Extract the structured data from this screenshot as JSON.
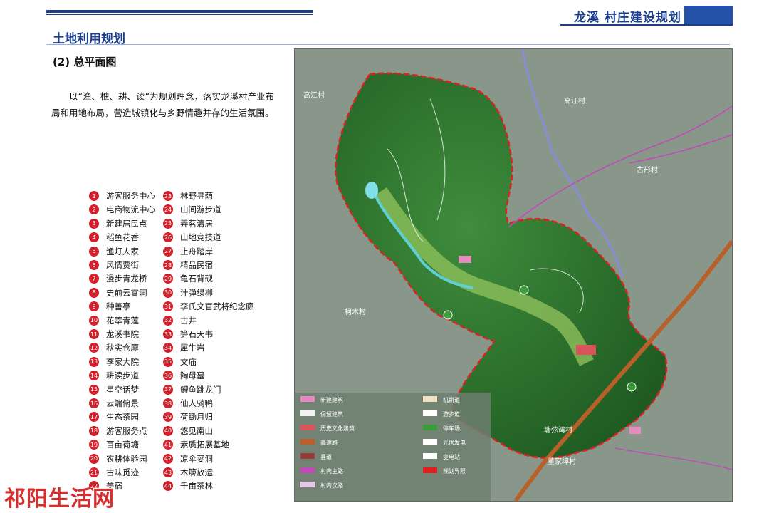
{
  "header": {
    "brand_title": "龙溪 村庄建设规划",
    "section_title": "土地利用规划",
    "subtitle": "(2) 总平面图",
    "paragraph": "以“渔、樵、耕、读”为规划理念，落实龙溪村产业布局和用地布局，营造城镇化与乡野情趣并存的生活氛围。"
  },
  "legend_left": [
    {
      "n": "1",
      "label": "游客服务中心"
    },
    {
      "n": "2",
      "label": "电商物流中心"
    },
    {
      "n": "3",
      "label": "新建居民点"
    },
    {
      "n": "4",
      "label": "稻鱼花香"
    },
    {
      "n": "5",
      "label": "渔灯人家"
    },
    {
      "n": "6",
      "label": "风情贾街"
    },
    {
      "n": "7",
      "label": "漫步青龙桥"
    },
    {
      "n": "8",
      "label": "史前云霄洞"
    },
    {
      "n": "9",
      "label": "种善亭"
    },
    {
      "n": "10",
      "label": "花萃青莲"
    },
    {
      "n": "11",
      "label": "龙溪书院"
    },
    {
      "n": "12",
      "label": "秋实仓廪"
    },
    {
      "n": "13",
      "label": "李家大院"
    },
    {
      "n": "14",
      "label": "耕读步道"
    },
    {
      "n": "15",
      "label": "星空话梦"
    },
    {
      "n": "16",
      "label": "云端俯景"
    },
    {
      "n": "17",
      "label": "生态茶园"
    },
    {
      "n": "18",
      "label": "游客服务点"
    },
    {
      "n": "19",
      "label": "百亩荷塘"
    },
    {
      "n": "20",
      "label": "农耕体验园"
    },
    {
      "n": "21",
      "label": "古味觅迹"
    },
    {
      "n": "22",
      "label": "美宿"
    }
  ],
  "legend_right": [
    {
      "n": "23",
      "label": "林野寻荫"
    },
    {
      "n": "24",
      "label": "山间游步道"
    },
    {
      "n": "25",
      "label": "弄茗清居"
    },
    {
      "n": "26",
      "label": "山地竞技道"
    },
    {
      "n": "27",
      "label": "止舟踏岸"
    },
    {
      "n": "28",
      "label": "精品民宿"
    },
    {
      "n": "29",
      "label": "龟石背砚"
    },
    {
      "n": "30",
      "label": "汁弹绿柳"
    },
    {
      "n": "31",
      "label": "李氏文官武将纪念廊"
    },
    {
      "n": "32",
      "label": "古井"
    },
    {
      "n": "33",
      "label": "笋石天书"
    },
    {
      "n": "34",
      "label": "犀牛岩"
    },
    {
      "n": "35",
      "label": "文庙"
    },
    {
      "n": "36",
      "label": "陶母墓"
    },
    {
      "n": "37",
      "label": "鲤鱼跳龙门"
    },
    {
      "n": "38",
      "label": "仙人骑鸭"
    },
    {
      "n": "39",
      "label": "荷锄月归"
    },
    {
      "n": "40",
      "label": "悠见南山"
    },
    {
      "n": "41",
      "label": "素质拓展基地"
    },
    {
      "n": "42",
      "label": "凉伞荽洞"
    },
    {
      "n": "43",
      "label": "木簰放运"
    },
    {
      "n": "44",
      "label": "千亩茶林"
    }
  ],
  "map": {
    "villages": [
      "高江村",
      "高江村",
      "古形村",
      "柯木村",
      "塘弦湾村",
      "董家埠村"
    ],
    "legend": [
      {
        "label": "新建建筑",
        "color": "#e68ac0"
      },
      {
        "label": "机耕道",
        "color": "#f0e0c0"
      },
      {
        "label": "保留建筑",
        "color": "#f2f2f2"
      },
      {
        "label": "游步道",
        "color": "#ffffff"
      },
      {
        "label": "历史文化建筑",
        "color": "#d9535c"
      },
      {
        "label": "停车场",
        "color": "#3a9d3a"
      },
      {
        "label": "高速路",
        "color": "#b8602a"
      },
      {
        "label": "光伏发电",
        "color": "#ffffff"
      },
      {
        "label": "县道",
        "color": "#9a3a3a"
      },
      {
        "label": "变电站",
        "color": "#ffffff"
      },
      {
        "label": "村内主路",
        "color": "#c24ab8"
      },
      {
        "label": "规划界限",
        "color": "#e02020"
      },
      {
        "label": "村内次路",
        "color": "#e8c8e8"
      }
    ]
  },
  "watermark": "祁阳生活网"
}
